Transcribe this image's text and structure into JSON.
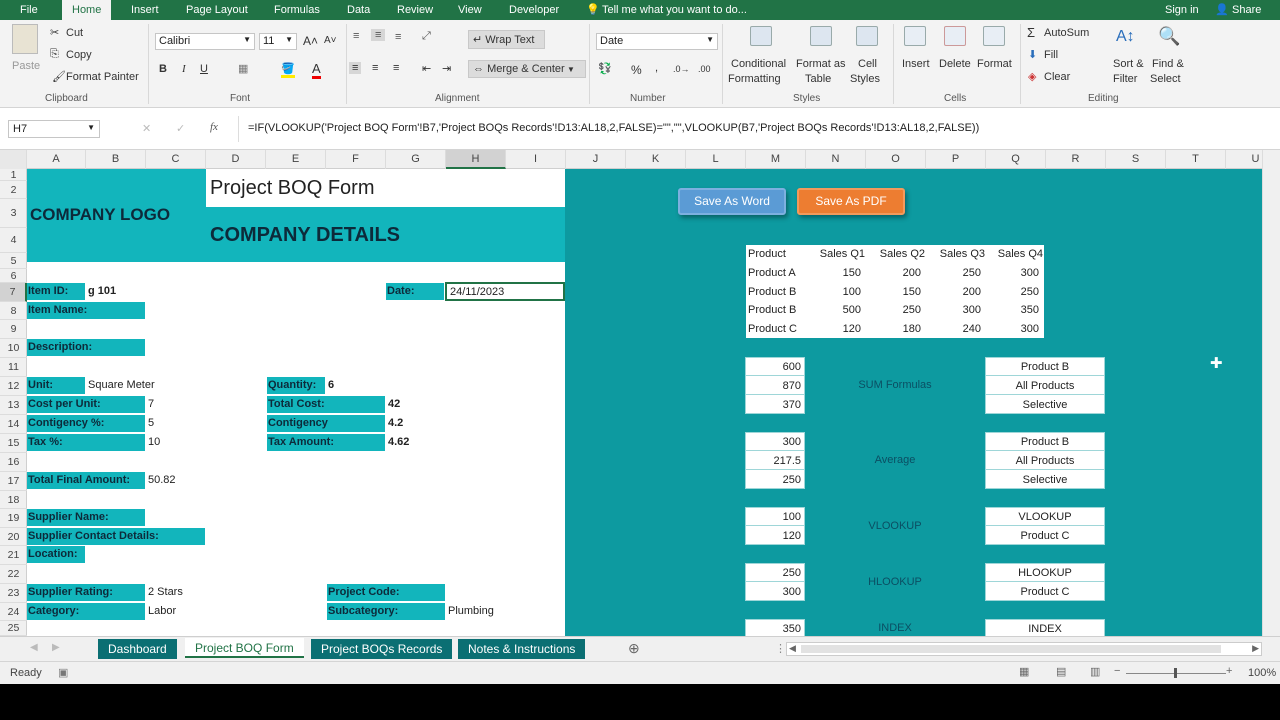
{
  "ribbon_tabs": [
    "File",
    "Home",
    "Insert",
    "Page Layout",
    "Formulas",
    "Data",
    "Review",
    "View",
    "Developer"
  ],
  "tell_me": "Tell me what you want to do...",
  "sign_in": "Sign in",
  "share": "Share",
  "clipboard": {
    "paste": "Paste",
    "cut": "Cut",
    "copy": "Copy",
    "format_painter": "Format Painter",
    "group": "Clipboard"
  },
  "font": {
    "name": "Calibri",
    "size": "11",
    "group": "Font",
    "bold": "B",
    "italic": "I",
    "underline": "U"
  },
  "alignment": {
    "wrap": "Wrap Text",
    "merge": "Merge & Center",
    "group": "Alignment"
  },
  "number": {
    "format": "Date",
    "group": "Number",
    "percent": "%"
  },
  "styles": {
    "cond": "Conditional",
    "cond2": "Formatting",
    "fmt_table": "Format as",
    "fmt_table2": "Table",
    "cell_styles": "Cell",
    "cell_styles2": "Styles",
    "group": "Styles"
  },
  "cells": {
    "insert": "Insert",
    "delete": "Delete",
    "format": "Format",
    "group": "Cells"
  },
  "editing": {
    "autosum": "AutoSum",
    "fill": "Fill",
    "clear": "Clear",
    "sort": "Sort &",
    "sort2": "Filter",
    "find": "Find &",
    "find2": "Select",
    "group": "Editing"
  },
  "name_box": "H7",
  "formula": "=IF(VLOOKUP('Project BOQ Form'!B7,'Project BOQs Records'!D13:AL18,2,FALSE)=\"\",\"\",VLOOKUP(B7,'Project BOQs Records'!D13:AL18,2,FALSE))",
  "columns": [
    "A",
    "B",
    "C",
    "D",
    "E",
    "F",
    "G",
    "H",
    "I",
    "J",
    "K",
    "L",
    "M",
    "N",
    "O",
    "P",
    "Q",
    "R",
    "S",
    "T",
    "U"
  ],
  "rows": [
    "1",
    "2",
    "3",
    "4",
    "5",
    "6",
    "7",
    "8",
    "9",
    "10",
    "11",
    "12",
    "13",
    "14",
    "15",
    "16",
    "17",
    "18",
    "19",
    "20",
    "21",
    "22",
    "23",
    "24",
    "25"
  ],
  "form": {
    "title": "Project BOQ Form",
    "logo": "COMPANY LOGO",
    "details": "COMPANY DETAILS",
    "item_id_label": "Item ID:",
    "item_id": "g 101",
    "date_label": "Date:",
    "date": "24/11/2023",
    "item_name_label": "Item Name:",
    "description_label": "Description:",
    "unit_label": "Unit:",
    "unit": "Square Meter",
    "quantity_label": "Quantity:",
    "quantity": "6",
    "cost_label": "Cost per Unit:",
    "cost": "7",
    "total_cost_label": "Total Cost:",
    "total_cost": "42",
    "contig_pct_label": "Contigency %:",
    "contig_pct": "5",
    "contig_label": "Contigency",
    "contig": "4.2",
    "tax_pct_label": "Tax %:",
    "tax_pct": "10",
    "tax_amount_label": "Tax Amount:",
    "tax_amount": "4.62",
    "total_final_label": "Total Final Amount:",
    "total_final": "50.82",
    "supplier_name_label": "Supplier Name:",
    "supplier_contact_label": "Supplier Contact Details:",
    "location_label": "Location:",
    "supplier_rating_label": "Supplier Rating:",
    "supplier_rating": "2 Stars",
    "project_code_label": "Project Code:",
    "category_label": "Category:",
    "category": "Labor",
    "subcategory_label": "Subcategory:",
    "subcategory": "Plumbing"
  },
  "buttons": {
    "save_word": "Save As Word",
    "save_pdf": "Save As PDF"
  },
  "sales_table": {
    "headers": [
      "Product",
      "Sales Q1",
      "Sales Q2",
      "Sales Q3",
      "Sales Q4"
    ],
    "rows": [
      [
        "Product A",
        "150",
        "200",
        "250",
        "300"
      ],
      [
        "Product B",
        "100",
        "150",
        "200",
        "250"
      ],
      [
        "Product B",
        "500",
        "250",
        "300",
        "350"
      ],
      [
        "Product C",
        "120",
        "180",
        "240",
        "300"
      ]
    ]
  },
  "formula_blocks": [
    {
      "label": "SUM Formulas",
      "values": [
        "600",
        "870",
        "370"
      ],
      "keys": [
        "Product B",
        "All Products",
        "Selective"
      ]
    },
    {
      "label": "Average",
      "values": [
        "300",
        "217.5",
        "250"
      ],
      "keys": [
        "Product B",
        "All Products",
        "Selective"
      ]
    },
    {
      "label": "VLOOKUP",
      "values": [
        "100",
        "120"
      ],
      "keys": [
        "VLOOKUP",
        "Product C"
      ]
    },
    {
      "label": "HLOOKUP",
      "values": [
        "250",
        "300"
      ],
      "keys": [
        "HLOOKUP",
        "Product C"
      ]
    },
    {
      "label": "INDEX",
      "values": [
        "350"
      ],
      "keys": [
        "INDEX"
      ]
    }
  ],
  "sheet_tabs": [
    "Dashboard",
    "Project BOQ Form",
    "Project BOQs Records",
    "Notes & Instructions"
  ],
  "status": {
    "ready": "Ready",
    "zoom": "100%"
  },
  "colors": {
    "excel_green": "#217346",
    "teal_panel": "#0d9aa0",
    "teal_label": "#12b5bc",
    "word_btn": "#5b9bd5",
    "pdf_btn": "#ed7d31"
  }
}
